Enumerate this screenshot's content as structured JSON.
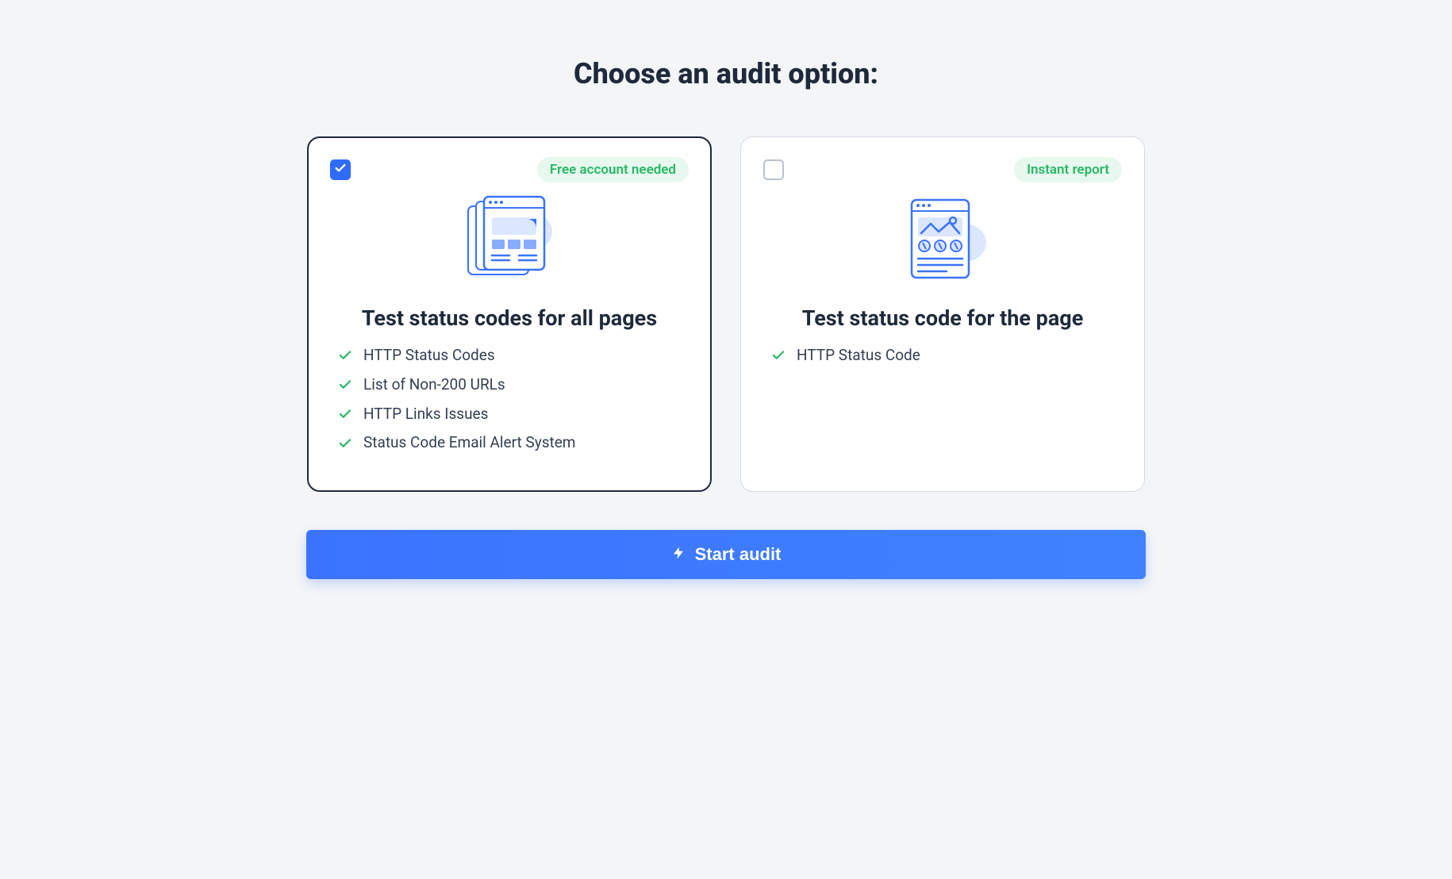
{
  "page_title": "Choose an audit option:",
  "options": [
    {
      "selected": true,
      "badge": "Free account needed",
      "title": "Test status codes for all pages",
      "features": [
        "HTTP Status Codes",
        "List of Non-200 URLs",
        "HTTP Links Issues",
        "Status Code Email Alert System"
      ]
    },
    {
      "selected": false,
      "badge": "Instant report",
      "title": "Test status code for the page",
      "features": [
        "HTTP Status Code"
      ]
    }
  ],
  "cta_label": "Start audit"
}
